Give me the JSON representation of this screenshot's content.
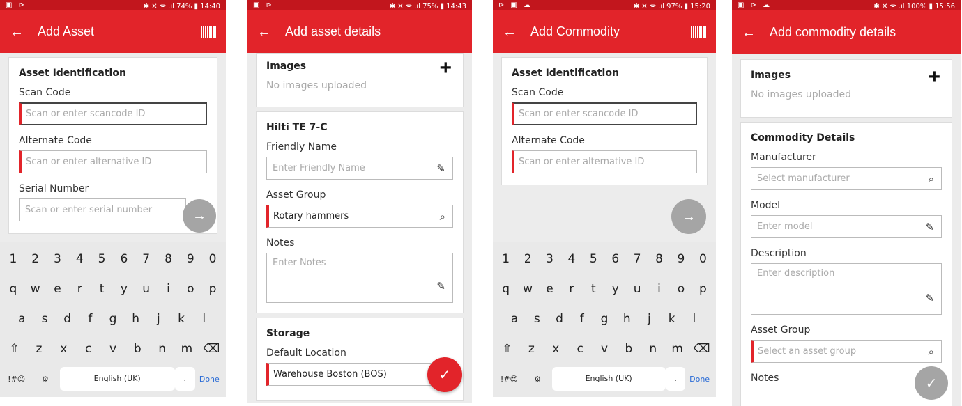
{
  "screens": [
    {
      "status": {
        "icons": "▣ ⊳",
        "right": "✱ ✕ ᯤ .ıl 74% ▮ 14:40"
      },
      "appbar": {
        "title": "Add Asset",
        "back_icon": "arrow-left",
        "barcode_icon": "barcode"
      },
      "card": {
        "section": "Asset Identification",
        "scan_label": "Scan Code",
        "scan_placeholder": "Scan or enter scancode ID",
        "alt_label": "Alternate Code",
        "alt_placeholder": "Scan or enter alternative ID",
        "serial_label": "Serial Number",
        "serial_placeholder": "Scan or enter serial number"
      }
    },
    {
      "status": {
        "icons": "▣ ⊳",
        "right": "✱ ✕ ᯤ .ıl 75% ▮ 14:43"
      },
      "appbar": {
        "title": "Add asset details"
      },
      "images": {
        "label": "Images",
        "empty": "No images uploaded"
      },
      "details": {
        "section": "Hilti TE 7-C",
        "friendly_label": "Friendly Name",
        "friendly_placeholder": "Enter Friendly Name",
        "group_label": "Asset Group",
        "group_value": "Rotary hammers",
        "notes_label": "Notes",
        "notes_placeholder": "Enter Notes"
      },
      "storage": {
        "section": "Storage",
        "location_label": "Default Location",
        "location_value": "Warehouse Boston (BOS)"
      }
    },
    {
      "status": {
        "icons": "⊳ ▣ ☁",
        "right": "✱ ✕ ᯤ .ıl 97% ▮ 15:20"
      },
      "appbar": {
        "title": "Add Commodity"
      },
      "card": {
        "section": "Asset Identification",
        "scan_label": "Scan Code",
        "scan_placeholder": "Scan or enter scancode ID",
        "alt_label": "Alternate Code",
        "alt_placeholder": "Scan or enter alternative ID"
      }
    },
    {
      "status": {
        "icons": "▣ ⊳ ☁",
        "right": "✱ ✕ ᯤ .ıl 100% ▮ 15:56"
      },
      "appbar": {
        "title": "Add commodity details"
      },
      "images": {
        "label": "Images",
        "empty": "No images uploaded"
      },
      "details": {
        "section": "Commodity Details",
        "manufacturer_label": "Manufacturer",
        "manufacturer_placeholder": "Select manufacturer",
        "model_label": "Model",
        "model_placeholder": "Enter model",
        "description_label": "Description",
        "description_placeholder": "Enter description",
        "group_label": "Asset Group",
        "group_placeholder": "Select an asset group",
        "notes_label": "Notes"
      }
    }
  ],
  "keyboard": {
    "row1": [
      "1",
      "2",
      "3",
      "4",
      "5",
      "6",
      "7",
      "8",
      "9",
      "0"
    ],
    "row2": [
      "q",
      "w",
      "e",
      "r",
      "t",
      "y",
      "u",
      "i",
      "o",
      "p"
    ],
    "row3": [
      "a",
      "s",
      "d",
      "f",
      "g",
      "h",
      "j",
      "k",
      "l"
    ],
    "row4": [
      "⇧",
      "z",
      "x",
      "c",
      "v",
      "b",
      "n",
      "m",
      "⌫"
    ],
    "symbols": "!#☺",
    "settings": "⚙",
    "space": "English (UK)",
    "period": ".",
    "done": "Done"
  },
  "colors": {
    "accent": "#e2242a",
    "statusbar": "#c2161d"
  }
}
